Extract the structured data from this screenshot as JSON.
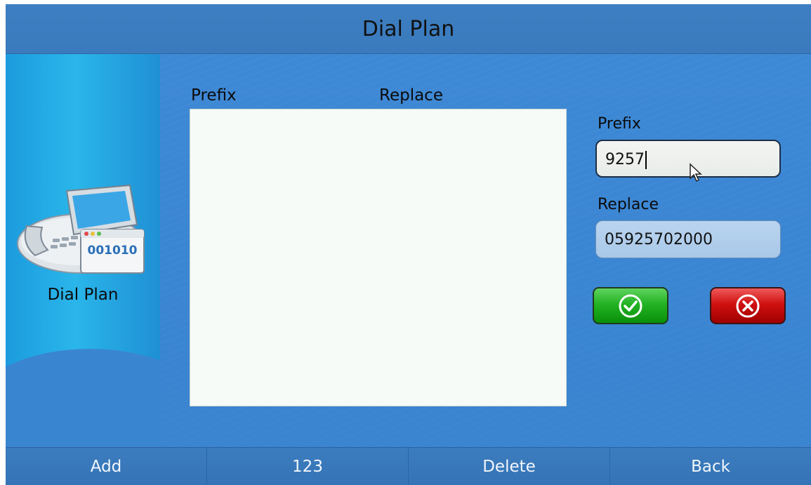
{
  "header": {
    "title": "Dial Plan"
  },
  "sidebar": {
    "label": "Dial Plan",
    "icon": "phone-dial-plan-icon",
    "icon_text": "001010"
  },
  "list": {
    "columns": [
      "Prefix",
      "Replace"
    ],
    "rows": []
  },
  "form": {
    "prefix_label": "Prefix",
    "prefix_value": "9257",
    "replace_label": "Replace",
    "replace_value": "05925702000",
    "ok_icon": "checkmark-icon",
    "cancel_icon": "cross-icon"
  },
  "softkeys": [
    "Add",
    "123",
    "Delete",
    "Back"
  ],
  "colors": {
    "ok": "#23b323",
    "cancel": "#d01010",
    "background": "#3b86d3"
  }
}
